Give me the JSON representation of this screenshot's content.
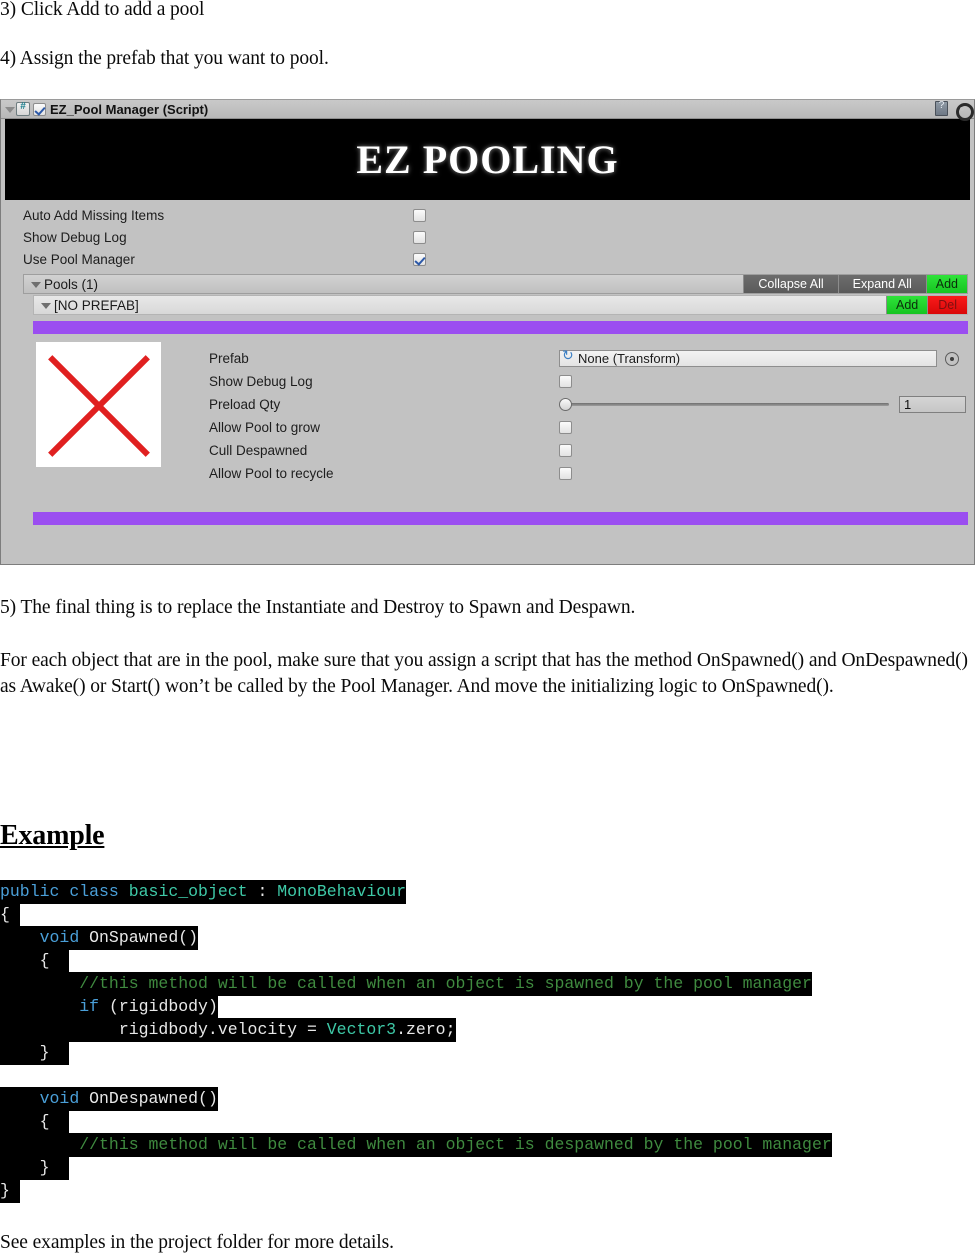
{
  "document": {
    "step3": "3) Click Add to add a pool",
    "step4": "4) Assign the prefab that you want to pool.",
    "step5": "5) The final thing is to replace the Instantiate and Destroy to Spawn and Despawn.",
    "body_paragraph": "For each object that are in the pool, make sure that you assign a script that has the method OnSpawned() and OnDespawned() as Awake() or Start() won’t be called by the Pool Manager. And move the initializing logic to OnSpawned().",
    "example_heading": "Example",
    "closing_line": "See examples in the project folder for more details."
  },
  "inspector": {
    "component_title": "EZ_Pool Manager (Script)",
    "component_enabled": true,
    "banner_text": "EZ POOLING",
    "icons": {
      "foldout": "triangle-down-icon",
      "script": "csharp-script-icon",
      "help": "help-book-icon",
      "settings": "gear-icon"
    },
    "properties": [
      {
        "label": "Auto Add Missing Items",
        "checked": false
      },
      {
        "label": "Show Debug Log",
        "checked": false
      },
      {
        "label": "Use Pool Manager",
        "checked": true
      }
    ],
    "pools_bar": {
      "label": "Pools (1)",
      "collapse_all": "Collapse All",
      "expand_all": "Expand All",
      "add": "Add"
    },
    "prefab_bar": {
      "label": "[NO PREFAB]",
      "add": "Add",
      "del": "Del"
    },
    "pool_detail": {
      "prefab_label": "Prefab",
      "prefab_value": "None (Transform)",
      "show_debug_log_label": "Show Debug Log",
      "show_debug_log_checked": false,
      "preload_qty_label": "Preload Qty",
      "preload_qty_value": "1",
      "allow_grow_label": "Allow Pool to grow",
      "allow_grow_checked": false,
      "cull_despawned_label": "Cull Despawned",
      "cull_despawned_checked": false,
      "allow_recycle_label": "Allow Pool to recycle",
      "allow_recycle_checked": false
    },
    "colors": {
      "panel_bg": "#c2c2c2",
      "add_button": "#18c81f",
      "del_button": "#e00808",
      "separator_purple": "#9b4ef0",
      "banner_bg": "#000000"
    }
  },
  "code": {
    "lines": [
      {
        "parts": [
          {
            "t": "public ",
            "c": "kw"
          },
          {
            "t": "class ",
            "c": "kw"
          },
          {
            "t": "basic_object",
            "c": "type"
          },
          {
            "t": " : ",
            "c": "pun"
          },
          {
            "t": "MonoBehaviour",
            "c": "type"
          }
        ]
      },
      {
        "parts": [
          {
            "t": "{ ",
            "c": "pun"
          }
        ]
      },
      {
        "parts": [
          {
            "t": "    ",
            "c": "pun"
          },
          {
            "t": "void ",
            "c": "kw"
          },
          {
            "t": "OnSpawned()",
            "c": "id"
          }
        ]
      },
      {
        "parts": [
          {
            "t": "    {  ",
            "c": "pun"
          }
        ]
      },
      {
        "parts": [
          {
            "t": "        ",
            "c": "pun"
          },
          {
            "t": "//this method will be called when an object is spawned by the pool manager",
            "c": "cmt"
          }
        ]
      },
      {
        "parts": [
          {
            "t": "        ",
            "c": "pun"
          },
          {
            "t": "if ",
            "c": "kw"
          },
          {
            "t": "(rigidbody)",
            "c": "id"
          }
        ]
      },
      {
        "parts": [
          {
            "t": "            rigidbody.velocity = ",
            "c": "id"
          },
          {
            "t": "Vector3",
            "c": "type"
          },
          {
            "t": ".zero;",
            "c": "id"
          }
        ]
      },
      {
        "parts": [
          {
            "t": "    }  ",
            "c": "pun"
          }
        ]
      },
      {
        "parts": [
          {
            "t": "",
            "c": "pun"
          }
        ]
      },
      {
        "parts": [
          {
            "t": "    ",
            "c": "pun"
          },
          {
            "t": "void ",
            "c": "kw"
          },
          {
            "t": "OnDespawned()",
            "c": "id"
          }
        ]
      },
      {
        "parts": [
          {
            "t": "    {  ",
            "c": "pun"
          }
        ]
      },
      {
        "parts": [
          {
            "t": "        ",
            "c": "pun"
          },
          {
            "t": "//this method will be called when an object is despawned by the pool manager",
            "c": "cmt"
          }
        ]
      },
      {
        "parts": [
          {
            "t": "    }  ",
            "c": "pun"
          }
        ]
      },
      {
        "parts": [
          {
            "t": "} ",
            "c": "pun"
          }
        ]
      }
    ],
    "colors": {
      "background": "#000000",
      "keyword": "#4a9fd8",
      "type": "#3ec9a7",
      "comment": "#3f8a3f",
      "identifier": "#e8e8e8"
    }
  }
}
